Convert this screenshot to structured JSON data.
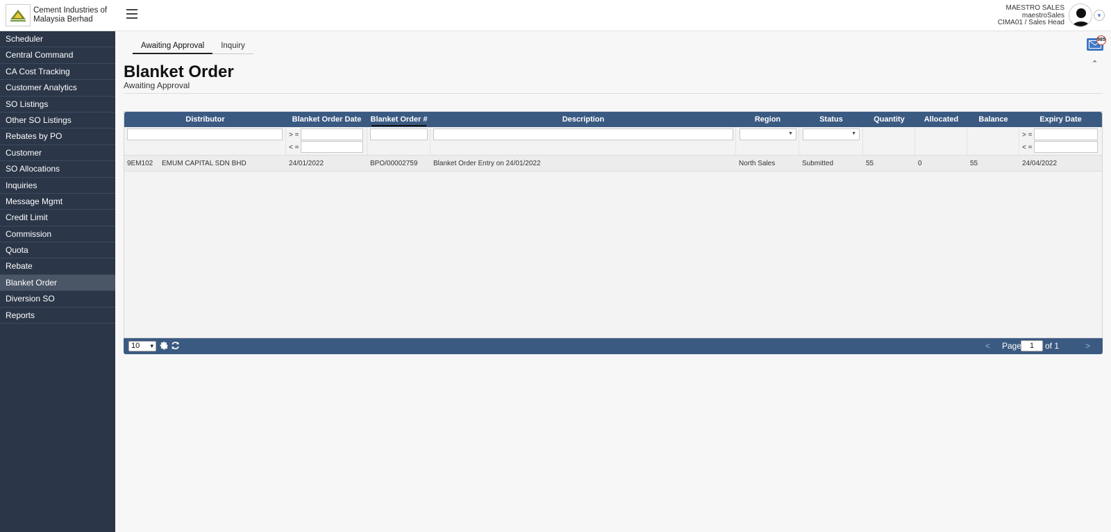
{
  "brand": {
    "name": "Cement Industries of Malaysia Berhad"
  },
  "sidebar": {
    "items": [
      {
        "label": "Scheduler"
      },
      {
        "label": "Central Command"
      },
      {
        "label": "CA Cost Tracking"
      },
      {
        "label": "Customer Analytics"
      },
      {
        "label": "SO Listings"
      },
      {
        "label": "Other SO Listings"
      },
      {
        "label": "Rebates by PO"
      },
      {
        "label": "Customer"
      },
      {
        "label": "SO Allocations"
      },
      {
        "label": "Inquiries"
      },
      {
        "label": "Message Mgmt"
      },
      {
        "label": "Credit Limit"
      },
      {
        "label": "Commission"
      },
      {
        "label": "Quota"
      },
      {
        "label": "Rebate"
      },
      {
        "label": "Blanket Order",
        "active": true
      },
      {
        "label": "Diversion SO"
      },
      {
        "label": "Reports"
      }
    ]
  },
  "user": {
    "display_name": "MAESTRO SALES",
    "username": "maestroSales",
    "role": "CIMA01 / Sales Head"
  },
  "tabs": [
    {
      "label": "Awaiting Approval",
      "active": true
    },
    {
      "label": "Inquiry",
      "active": false
    }
  ],
  "page": {
    "title": "Blanket Order",
    "subtitle": "Awaiting Approval",
    "mail_count": "985"
  },
  "grid": {
    "columns": [
      "Distributor",
      "Blanket Order Date",
      "Blanket Order #",
      "Description",
      "Region",
      "Status",
      "Quantity",
      "Allocated",
      "Balance",
      "Expiry Date"
    ],
    "filters": {
      "ge": "> =",
      "le": "< ="
    },
    "rows": [
      {
        "distributor_code": "9EM102",
        "distributor_name": "EMUM CAPITAL SDN BHD",
        "date": "24/01/2022",
        "order_no": "BPO/00002759",
        "description": "Blanket Order Entry on 24/01/2022",
        "region": "North Sales",
        "status": "Submitted",
        "quantity": "55",
        "allocated": "0",
        "balance": "55",
        "expiry": "24/04/2022"
      }
    ]
  },
  "pager": {
    "page_size": "10",
    "page_label": "Page",
    "current_page": "1",
    "of_label": "of 1",
    "prev": "<",
    "next": ">"
  },
  "colors": {
    "sidebar_bg": "#2b3648",
    "grid_header": "#3b5a82",
    "mail_blue": "#3e77c4"
  }
}
